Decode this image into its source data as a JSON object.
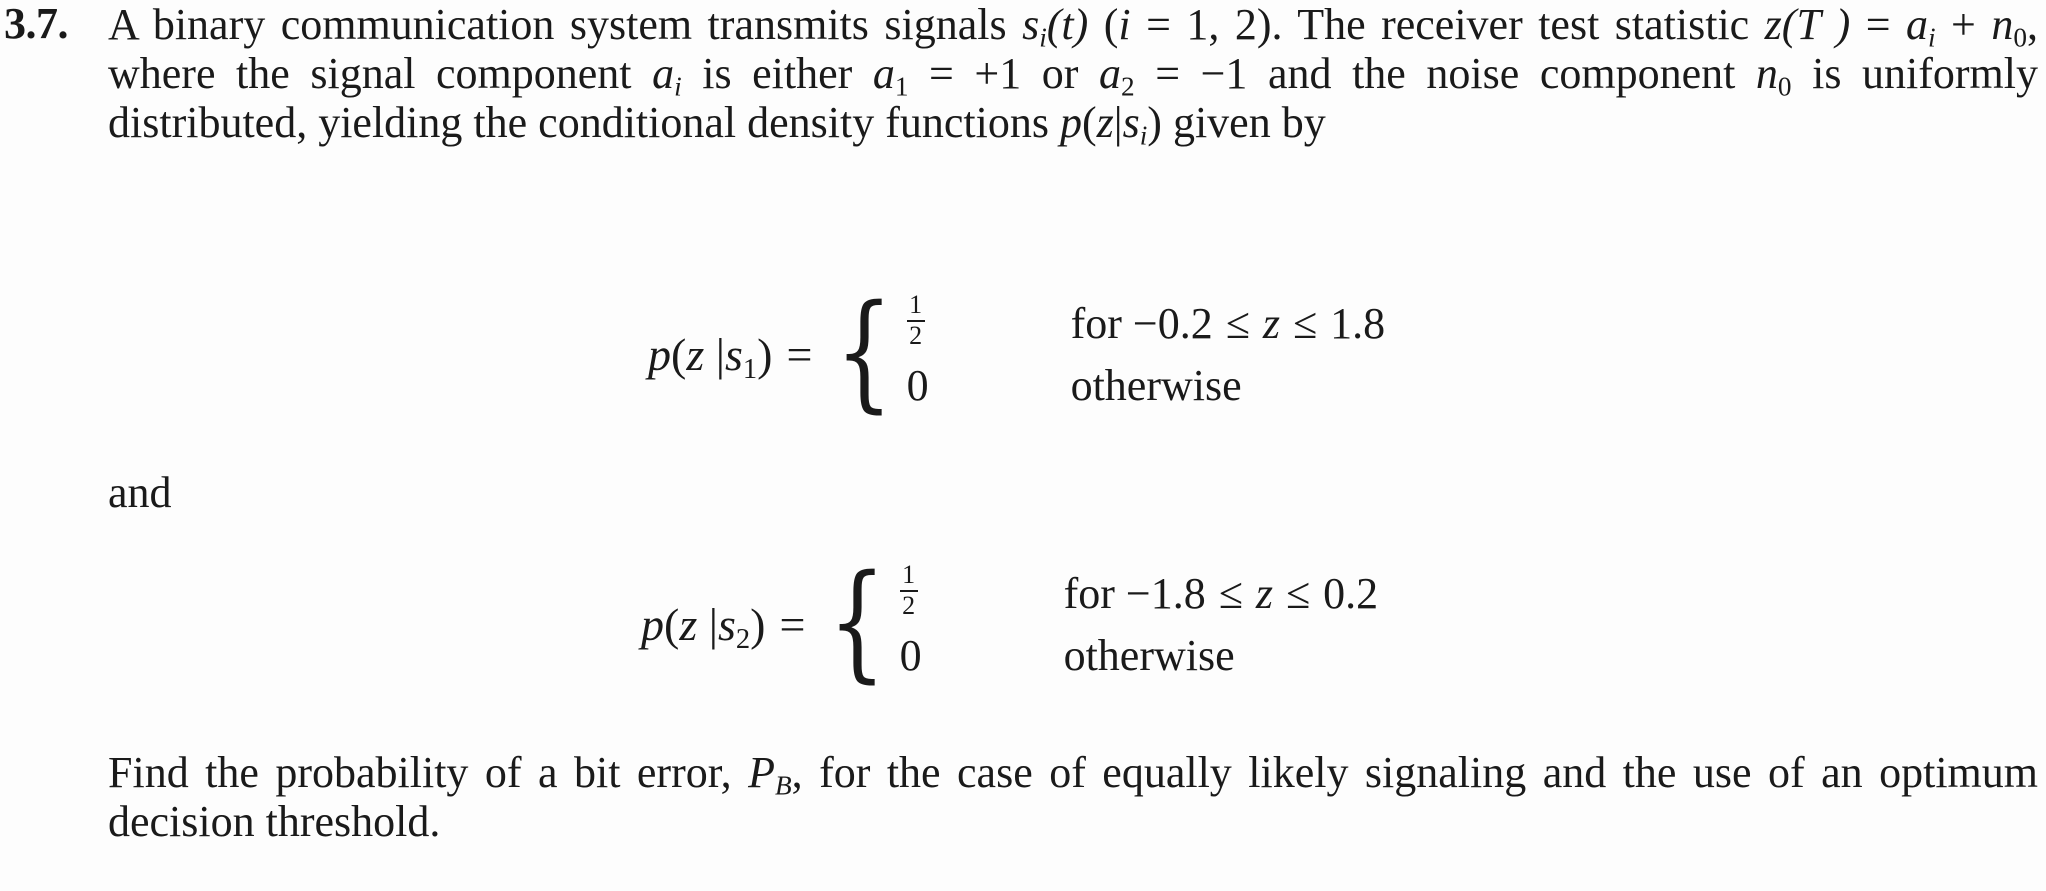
{
  "problem": {
    "number": "3.7.",
    "intro": {
      "line1_a": "A binary communication system transmits signals ",
      "sig_s": "s",
      "sig_s_sub": "i",
      "sig_t": "(t)",
      "paren_i_open": "(",
      "var_i": "i",
      "eq1_text": " = 1, 2",
      "paren_i_close": "). The receiver test",
      "line2_a": "statistic ",
      "var_z": "z",
      "var_T": "(T )",
      "eq_sign": " = ",
      "var_a": "a",
      "var_a_sub": "i",
      "plus_n": " + ",
      "var_n": "n",
      "var_n_sub": "0",
      "line2_b": ", where the signal component ",
      "var_a2": "a",
      "var_a2_sub": "i",
      "line2_c": " is either ",
      "var_a1": "a",
      "var_a1_sub": "1",
      "val_a1": " = +1",
      "or_text": " or ",
      "var_a2b": "a",
      "var_a2b_sub": "2",
      "val_a2": " = −1",
      "line2_d": " and",
      "line3_a": "the noise component ",
      "var_n0": "n",
      "var_n0_sub": "0",
      "line3_b": " is uniformly distributed, yielding the conditional density",
      "line4_a": "functions ",
      "func_p": "p",
      "func_open": "(",
      "func_z": "z",
      "func_bar": "|",
      "func_s": "s",
      "func_s_sub": "i",
      "func_close": ")",
      "line4_b": " given by"
    },
    "connector": "and",
    "equations": [
      {
        "name": "density-s1",
        "lhs_p": "p",
        "lhs_open": "(",
        "lhs_z": "z ",
        "lhs_bar": "|",
        "lhs_s": "s",
        "lhs_s_sub": "1",
        "lhs_close": ")",
        "equals": "=",
        "brace": "{",
        "case1_num": "1",
        "case1_den": "2",
        "case1_cond_for": "for −0.2 ",
        "case1_cond_le1": "≤",
        "case1_cond_z": " z ",
        "case1_cond_le2": "≤",
        "case1_cond_hi": " 1.8",
        "case2_value": "0",
        "case2_cond": "otherwise"
      },
      {
        "name": "density-s2",
        "lhs_p": "p",
        "lhs_open": "(",
        "lhs_z": "z ",
        "lhs_bar": "|",
        "lhs_s": "s",
        "lhs_s_sub": "2",
        "lhs_close": ")",
        "equals": "=",
        "brace": "{",
        "case1_num": "1",
        "case1_den": "2",
        "case1_cond_for": "for −1.8 ",
        "case1_cond_le1": "≤",
        "case1_cond_z": " z  ",
        "case1_cond_le2": "≤",
        "case1_cond_hi": " 0.2",
        "case2_value": "0",
        "case2_cond": "otherwise"
      }
    ],
    "tail": {
      "line1_a": "Find the probability of a bit error, ",
      "var_P": "P",
      "var_P_sub": "B",
      "line1_b": ", for the case of equally likely signaling and the",
      "line2": "use of an optimum decision threshold."
    }
  }
}
